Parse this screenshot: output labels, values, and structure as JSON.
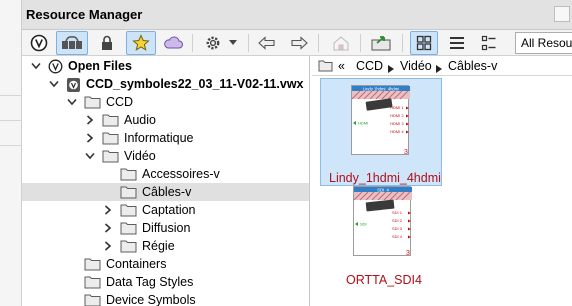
{
  "window": {
    "title": "Resource Manager"
  },
  "toolbar": {
    "buttons": [
      {
        "name": "vectorworks-logo-icon"
      },
      {
        "name": "cloud-folders-icon"
      },
      {
        "name": "lock-icon"
      },
      {
        "name": "favorites-star-icon"
      },
      {
        "name": "cloud-icon"
      },
      {
        "name": "gear-icon"
      },
      {
        "name": "chevron-down-icon"
      },
      {
        "name": "back-arrow-icon"
      },
      {
        "name": "forward-arrow-icon"
      },
      {
        "name": "home-icon"
      },
      {
        "name": "import-icon"
      },
      {
        "name": "thumbnail-view-icon"
      },
      {
        "name": "list-view-icon"
      },
      {
        "name": "detail-view-icon"
      }
    ],
    "library_select": "All Resources"
  },
  "tree": {
    "items": [
      {
        "label": "Open Files",
        "bold": true,
        "state": "open"
      },
      {
        "label": "CCD_symboles22_03_11-V02-11.vwx",
        "bold": true,
        "state": "open"
      },
      {
        "label": "CCD",
        "state": "open"
      },
      {
        "label": "Audio",
        "state": "closed"
      },
      {
        "label": "Informatique",
        "state": "closed"
      },
      {
        "label": "Vidéo",
        "state": "open"
      },
      {
        "label": "Accessoires-v",
        "state": "none"
      },
      {
        "label": "Câbles-v",
        "state": "none",
        "selected": true
      },
      {
        "label": "Captation",
        "state": "closed"
      },
      {
        "label": "Diffusion",
        "state": "closed"
      },
      {
        "label": "Régie",
        "state": "closed"
      },
      {
        "label": "Containers",
        "state": "none"
      },
      {
        "label": "Data Tag Styles",
        "state": "none"
      },
      {
        "label": "Device Symbols",
        "state": "none"
      }
    ]
  },
  "breadcrumb": {
    "prefix": "«",
    "parts": [
      "CCD",
      "Vidéo",
      "Câbles-v"
    ]
  },
  "resources": [
    {
      "name": "Lindy_1hdmi_4hdmi",
      "header": "Lindy 1hdmi_4hdmi",
      "ports_in": [
        "HDMI"
      ],
      "ports_out": [
        "HDMI 1",
        "HDMI 2",
        "HDMI 3",
        "HDMI 4"
      ],
      "selected": true
    },
    {
      "name": "ORTTA_SDI4",
      "header": "SDI_4",
      "ports_in": [
        "SDI"
      ],
      "ports_out": [
        "SDI 1",
        "SDI 2",
        "SDI 3",
        "SDI 4"
      ],
      "selected": false
    }
  ],
  "colors": {
    "selection": "#cfe5fa",
    "resource_name": "#b0101a",
    "thumb_header": "#2f7fc9",
    "port_in": "#2a9a2a",
    "port_out": "#c0101a"
  }
}
